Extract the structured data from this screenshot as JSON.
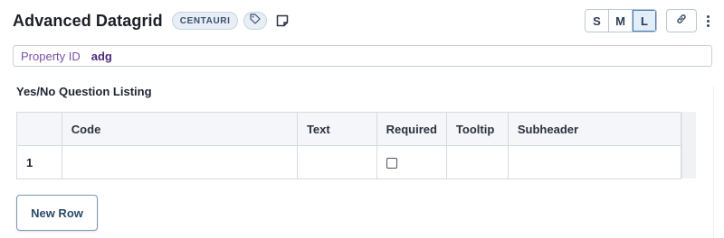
{
  "header": {
    "title": "Advanced Datagrid",
    "badge": "CENTAURI",
    "tag_icon": "tag-icon",
    "note_icon": "note-icon",
    "sizes": [
      "S",
      "M",
      "L"
    ],
    "active_size": "L",
    "link_icon": "link-icon",
    "more_icon": "kebab-menu-icon"
  },
  "property": {
    "label": "Property ID",
    "value": "adg"
  },
  "grid": {
    "title": "Yes/No Question Listing",
    "columns": [
      "",
      "Code",
      "Text",
      "Required",
      "Tooltip",
      "Subheader"
    ],
    "rows": [
      {
        "num": "1",
        "code": "",
        "text": "",
        "required": false,
        "tooltip": "",
        "subheader": ""
      }
    ]
  },
  "actions": {
    "new_row_label": "New Row"
  },
  "colors": {
    "accent": "#4a7fb3",
    "property_label": "#7a4fa8",
    "property_value": "#4a2a78"
  }
}
